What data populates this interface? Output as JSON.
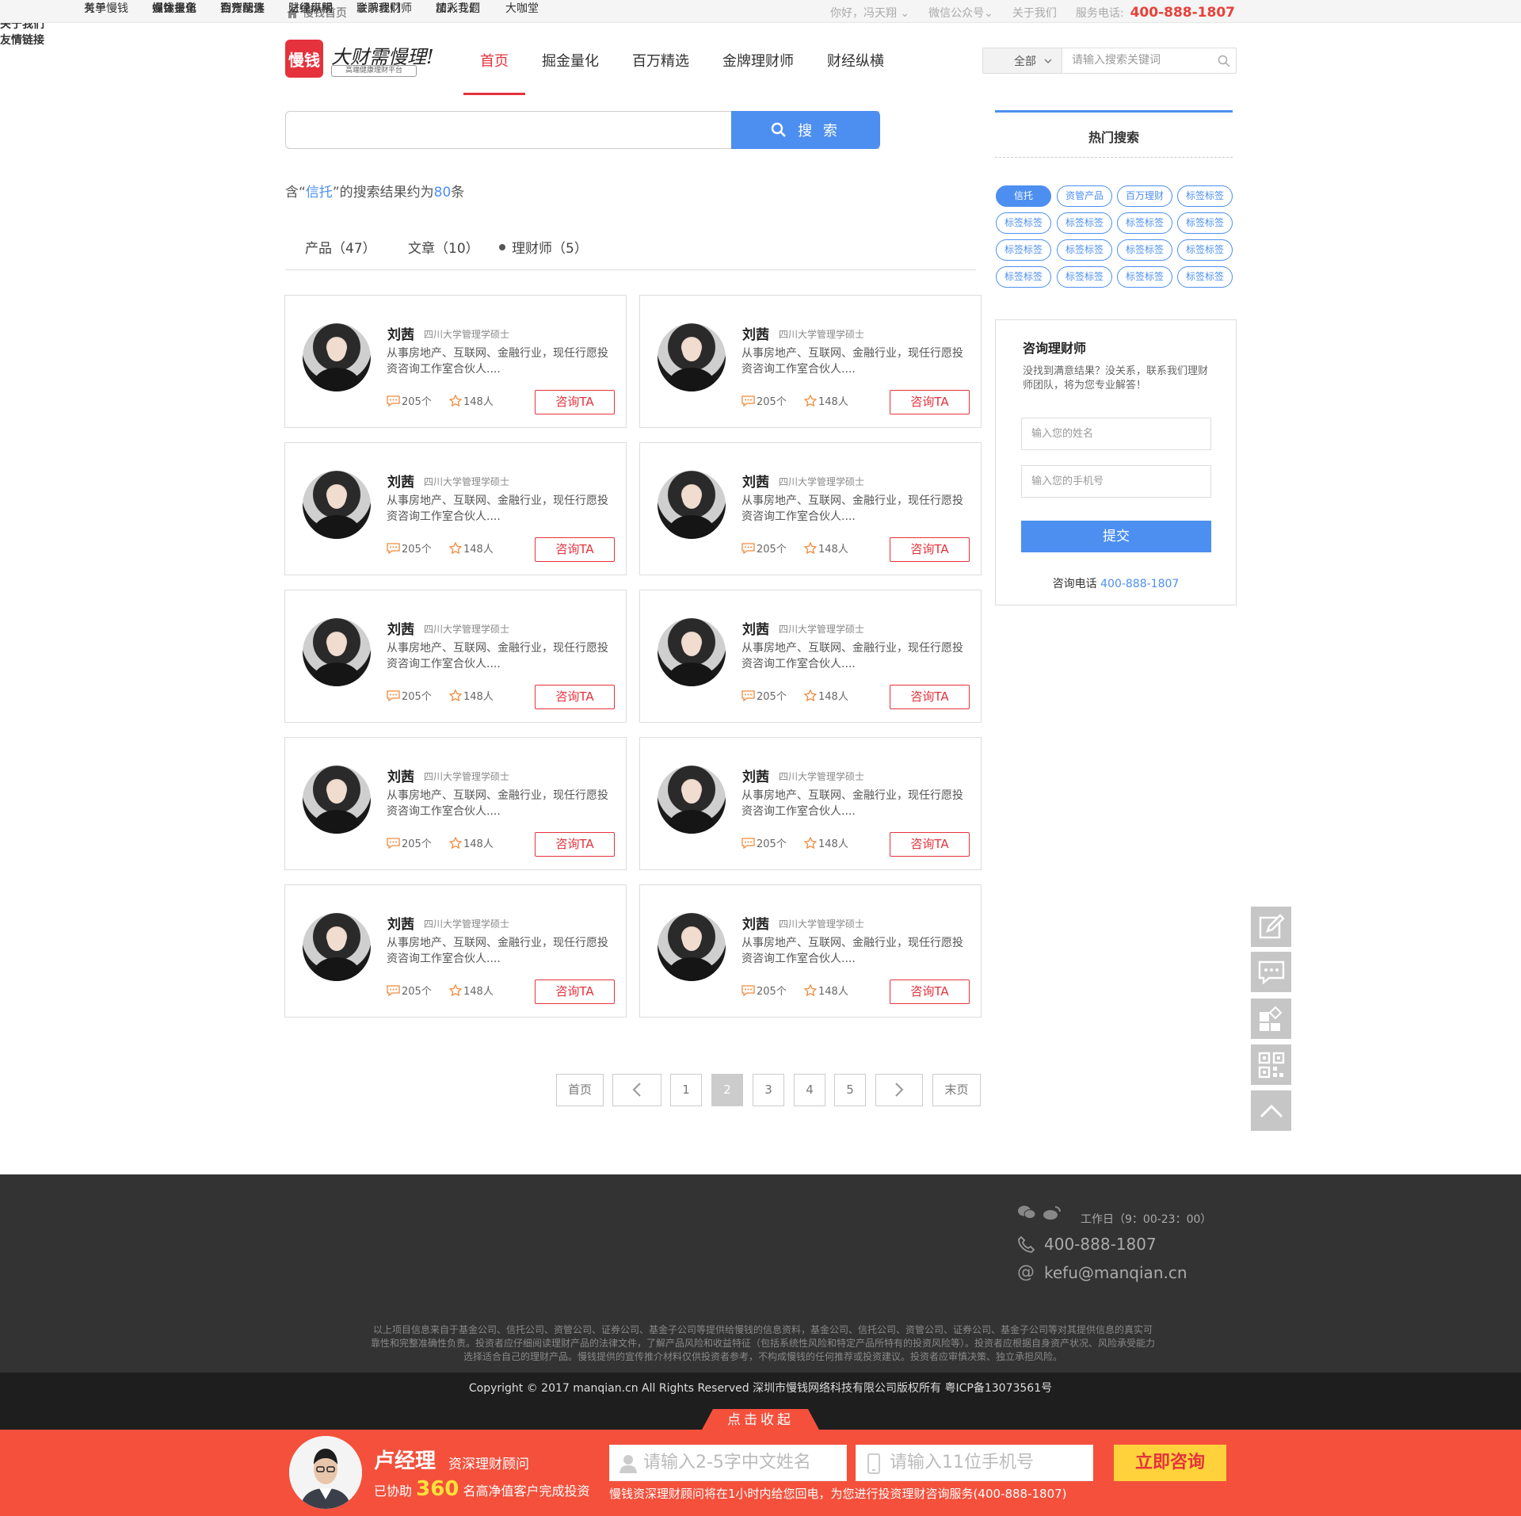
{
  "topbar": {
    "home_label": "慢钱首页",
    "greeting": "你好，冯天翔",
    "wechat": "微信公众号",
    "about": "关于我们",
    "service_label": "服务电话:",
    "service_phone": "400-888-1807"
  },
  "header": {
    "logo_text": "慢钱",
    "slogan": "大财需慢理!",
    "slogan_sub": "高端健康理财平台",
    "nav": [
      "首页",
      "掘金量化",
      "百万精选",
      "金牌理财师",
      "财经纵横"
    ],
    "search": {
      "scope": "全部",
      "placeholder": "请输入搜索关键词"
    }
  },
  "search": {
    "button_label": "搜 索",
    "result_prefix": "含“",
    "keyword": "信托",
    "result_mid": "”的搜索结果约为",
    "count": "80",
    "result_suffix": "条"
  },
  "tabs": [
    "产品（47）",
    "文章（10）",
    "理财师（5）"
  ],
  "cards": [
    {
      "name": "刘茜",
      "edu": "四川大学管理学硕士",
      "desc": "从事房地产、互联网、金融行业，现任行愿投资咨询工作室合伙人....",
      "comments": "205个",
      "fans": "148人",
      "button": "咨询TA"
    },
    {
      "name": "刘茜",
      "edu": "四川大学管理学硕士",
      "desc": "从事房地产、互联网、金融行业，现任行愿投资咨询工作室合伙人....",
      "comments": "205个",
      "fans": "148人",
      "button": "咨询TA"
    },
    {
      "name": "刘茜",
      "edu": "四川大学管理学硕士",
      "desc": "从事房地产、互联网、金融行业，现任行愿投资咨询工作室合伙人....",
      "comments": "205个",
      "fans": "148人",
      "button": "咨询TA"
    },
    {
      "name": "刘茜",
      "edu": "四川大学管理学硕士",
      "desc": "从事房地产、互联网、金融行业，现任行愿投资咨询工作室合伙人....",
      "comments": "205个",
      "fans": "148人",
      "button": "咨询TA"
    },
    {
      "name": "刘茜",
      "edu": "四川大学管理学硕士",
      "desc": "从事房地产、互联网、金融行业，现任行愿投资咨询工作室合伙人....",
      "comments": "205个",
      "fans": "148人",
      "button": "咨询TA"
    },
    {
      "name": "刘茜",
      "edu": "四川大学管理学硕士",
      "desc": "从事房地产、互联网、金融行业，现任行愿投资咨询工作室合伙人....",
      "comments": "205个",
      "fans": "148人",
      "button": "咨询TA"
    },
    {
      "name": "刘茜",
      "edu": "四川大学管理学硕士",
      "desc": "从事房地产、互联网、金融行业，现任行愿投资咨询工作室合伙人....",
      "comments": "205个",
      "fans": "148人",
      "button": "咨询TA"
    },
    {
      "name": "刘茜",
      "edu": "四川大学管理学硕士",
      "desc": "从事房地产、互联网、金融行业，现任行愿投资咨询工作室合伙人....",
      "comments": "205个",
      "fans": "148人",
      "button": "咨询TA"
    },
    {
      "name": "刘茜",
      "edu": "四川大学管理学硕士",
      "desc": "从事房地产、互联网、金融行业，现任行愿投资咨询工作室合伙人....",
      "comments": "205个",
      "fans": "148人",
      "button": "咨询TA"
    },
    {
      "name": "刘茜",
      "edu": "四川大学管理学硕士",
      "desc": "从事房地产、互联网、金融行业，现任行愿投资咨询工作室合伙人....",
      "comments": "205个",
      "fans": "148人",
      "button": "咨询TA"
    }
  ],
  "pagination": {
    "first": "首页",
    "pages": [
      "1",
      "2",
      "3",
      "4",
      "5"
    ],
    "current": "2",
    "last": "末页"
  },
  "hot": {
    "title": "热门搜索",
    "tags": [
      "信托",
      "资管产品",
      "百万理财",
      "标签标签",
      "标签标签",
      "标签标签",
      "标签标签",
      "标签标签",
      "标签标签",
      "标签标签",
      "标签标签",
      "标签标签",
      "标签标签",
      "标签标签",
      "标签标签",
      "标签标签"
    ]
  },
  "consult": {
    "title": "咨询理财师",
    "tip": "没找到满意结果？没关系，联系我们理财师团队，将为您专业解答！",
    "name_placeholder": "输入您的姓名",
    "phone_placeholder": "输入您的手机号",
    "submit": "提交",
    "tel_label": "咨询电话",
    "tel": "400-888-1807"
  },
  "footer": {
    "rows": [
      {
        "title": "网站导航",
        "links": [
          "首页",
          "掘金量化",
          "百万精选",
          "财经纵横",
          "金牌理财师",
          "精彩专题",
          "大咖堂"
        ]
      },
      {
        "title": "关于我们",
        "links": [
          "关于慢钱",
          "媒体报道",
          "合作伙伴",
          "法律声明",
          "联系我们",
          "加入我们"
        ]
      },
      {
        "title": "友情链接",
        "links": [
          "有单",
          "慢钱头条",
          "期货配资"
        ]
      }
    ],
    "workday": "工作日（9：00-23：00）",
    "phone": "400-888-1807",
    "email": "kefu@manqian.cn",
    "disclaimer": "以上项目信息来自于基金公司、信托公司、资管公司、证券公司、基金子公司等提供给慢钱的信息资料，基金公司、信托公司、资管公司、证券公司、基金子公司等对其提供信息的真实可靠性和完整准确性负责。投资者应仔细阅读理财产品的法律文件，了解产品风险和收益特征（包括系统性风险和特定产品所特有的投资风险等）。投资者应根据自身资产状况、风险承受能力选择适合自己的理财产品。慢钱提供的宣传推介材料仅供投资者参考，不构成慢钱的任何推荐或投资建议。投资者应审慎决策、独立承担风险。",
    "copyright": "Copyright © 2017 manqian.cn All Rights Reserved 深圳市慢钱网络科技有限公司版权所有 粤ICP备13073561号"
  },
  "bottom": {
    "fold": "点击收起",
    "manager_name": "卢经理",
    "manager_role": "资深理财顾问",
    "help_prefix": "已协助",
    "help_count": "360",
    "help_suffix": "名高净值客户完成投资",
    "name_placeholder": "请输入2-5字中文姓名",
    "phone_placeholder": "请输入11位手机号",
    "submit": "立即咨询",
    "note": "慢钱资深理财顾问将在1小时内给您回电，为您进行投资理财咨询服务(400-888-1807)"
  },
  "colors": {
    "brand_red": "#e5323c",
    "accent_blue": "#4d8ff0",
    "bar_orange": "#f4503c"
  }
}
